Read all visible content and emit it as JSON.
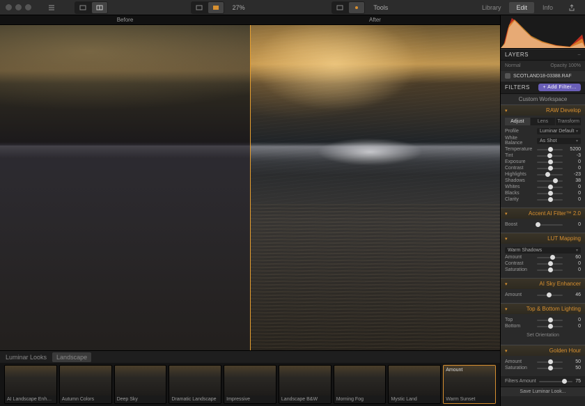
{
  "topbar": {
    "zoom": "27%",
    "tools_label": "Tools",
    "right_tabs": [
      "Library",
      "Edit",
      "Info"
    ],
    "right_active": 1
  },
  "compare": {
    "before": "Before",
    "after": "After"
  },
  "looks": {
    "header_label": "Luminar Looks",
    "category": "Landscape",
    "items": [
      {
        "name": "AI Landscape Enhancer"
      },
      {
        "name": "Autumn Colors"
      },
      {
        "name": "Deep Sky"
      },
      {
        "name": "Dramatic Landscape"
      },
      {
        "name": "Impressive"
      },
      {
        "name": "Landscape B&W"
      },
      {
        "name": "Morning Fog"
      },
      {
        "name": "Mystic Land"
      },
      {
        "name": "Warm Sunset",
        "selected": true,
        "amount_label": "Amount",
        "amount_value": ""
      }
    ]
  },
  "panel": {
    "layers": {
      "title": "LAYERS",
      "sub_left": "Normal",
      "sub_right": "Opacity 100%",
      "layer_name": "SCOTLAND18-03388.RAF"
    },
    "filters": {
      "title": "FILTERS",
      "add": "+ Add Filter...",
      "workspace": "Custom Workspace"
    },
    "raw": {
      "title": "RAW Develop",
      "tabs": [
        "Adjust",
        "Lens",
        "Transform"
      ],
      "tab_active": 0,
      "profile": {
        "label": "Profile",
        "value": "Luminar Default"
      },
      "wb": {
        "label": "White Balance",
        "value": "As Shot"
      },
      "sliders": [
        {
          "label": "Temperature",
          "value": 5200,
          "pos": 50
        },
        {
          "label": "Tint",
          "value": -3,
          "pos": 49
        },
        {
          "label": "Exposure",
          "value": 0,
          "pos": 50
        },
        {
          "label": "Contrast",
          "value": 0,
          "pos": 50
        },
        {
          "label": "Highlights",
          "value": -23,
          "pos": 40
        },
        {
          "label": "Shadows",
          "value": 38,
          "pos": 69
        },
        {
          "label": "Whites",
          "value": 0,
          "pos": 50
        },
        {
          "label": "Blacks",
          "value": 0,
          "pos": 50
        },
        {
          "label": "Clarity",
          "value": 0,
          "pos": 50
        }
      ]
    },
    "accent": {
      "title": "Accent AI Filter™ 2.0",
      "sliders": [
        {
          "label": "Boost",
          "value": 0,
          "pos": 2
        }
      ]
    },
    "lut": {
      "title": "LUT Mapping",
      "dropdown": {
        "label": "",
        "value": "Warm Shadows"
      },
      "sliders": [
        {
          "label": "Amount",
          "value": 60,
          "pos": 60
        },
        {
          "label": "Contrast",
          "value": 0,
          "pos": 50
        },
        {
          "label": "Saturation",
          "value": 0,
          "pos": 50
        }
      ]
    },
    "sky": {
      "title": "AI Sky Enhancer",
      "sliders": [
        {
          "label": "Amount",
          "value": 46,
          "pos": 46
        }
      ]
    },
    "tb": {
      "title": "Top & Bottom Lighting",
      "sliders": [
        {
          "label": "Top",
          "value": 0,
          "pos": 50
        },
        {
          "label": "Bottom",
          "value": 0,
          "pos": 50
        }
      ],
      "orientation_btn": "Set Orientation"
    },
    "golden": {
      "title": "Golden Hour",
      "sliders": [
        {
          "label": "Amount",
          "value": 50,
          "pos": 50
        },
        {
          "label": "Saturation",
          "value": 50,
          "pos": 50
        }
      ]
    },
    "filters_amount": {
      "label": "Filters Amount",
      "value": 75,
      "pos": 75
    },
    "save": "Save Luminar Look..."
  }
}
